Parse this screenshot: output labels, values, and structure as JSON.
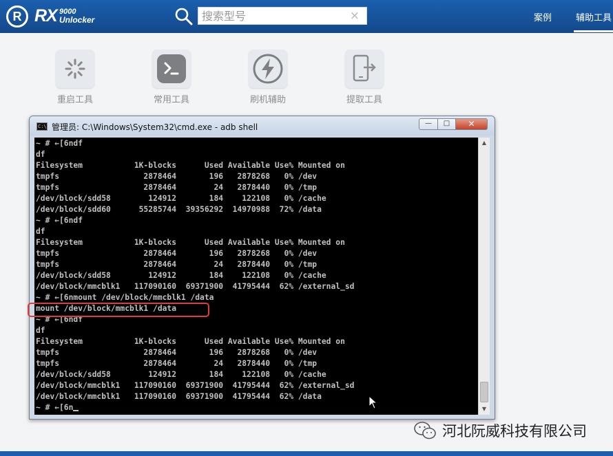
{
  "app": {
    "logo_letter": "R",
    "logo_rx": "RX",
    "logo_model": "9000",
    "logo_sub": "Unlocker",
    "search": {
      "placeholder": "搜索型号",
      "clear": "×"
    },
    "nav": {
      "cases": "案例",
      "tools": "辅助工具"
    },
    "accent_color": "#1b5fae"
  },
  "tools": [
    {
      "label": "重启工具",
      "icon": "restart-spinner-icon"
    },
    {
      "label": "常用工具",
      "icon": "terminal-prompt-icon"
    },
    {
      "label": "刷机辅助",
      "icon": "flash-bolt-icon"
    },
    {
      "label": "提取工具",
      "icon": "phone-extract-icon"
    }
  ],
  "cmd_window": {
    "title": "管理员: C:\\Windows\\System32\\cmd.exe - adb  shell",
    "icon_text": "C:\\",
    "buttons": {
      "minimize": "—",
      "maximize": "□",
      "close": "✕"
    },
    "lines": [
      "~ # ←[6ndf",
      "df",
      "Filesystem           1K-blocks      Used Available Use% Mounted on",
      "tmpfs                  2878464       196   2878268   0% /dev",
      "tmpfs                  2878464        24   2878440   0% /tmp",
      "/dev/block/sdd58        124912       184    122108   0% /cache",
      "/dev/block/sdd60      55285744  39356292  14970988  72% /data",
      "~ # ←[6ndf",
      "df",
      "Filesystem           1K-blocks      Used Available Use% Mounted on",
      "tmpfs                  2878464       196   2878268   0% /dev",
      "tmpfs                  2878464        24   2878440   0% /tmp",
      "/dev/block/sdd58        124912       184    122108   0% /cache",
      "/dev/block/mmcblk1   117090160  69371900  41795444  62% /external_sd",
      "~ # ←[6nmount /dev/block/mmcblk1 /data",
      "mount /dev/block/mmcblk1 /data",
      "~ # ←[6ndf",
      "df",
      "Filesystem           1K-blocks      Used Available Use% Mounted on",
      "tmpfs                  2878464       196   2878268   0% /dev",
      "tmpfs                  2878464        24   2878440   0% /tmp",
      "/dev/block/sdd58        124912       184    122108   0% /cache",
      "/dev/block/mmcblk1   117090160  69371900  41795444  62% /external_sd",
      "/dev/block/mmcblk1   117090160  69371900  41795444  62% /data",
      "~ # ←[6n"
    ],
    "highlighted_line_index": 15,
    "highlight_color": "#e23b3b"
  },
  "watermark": {
    "text": "河北阮威科技有限公司",
    "icon": "wechat-icon"
  }
}
